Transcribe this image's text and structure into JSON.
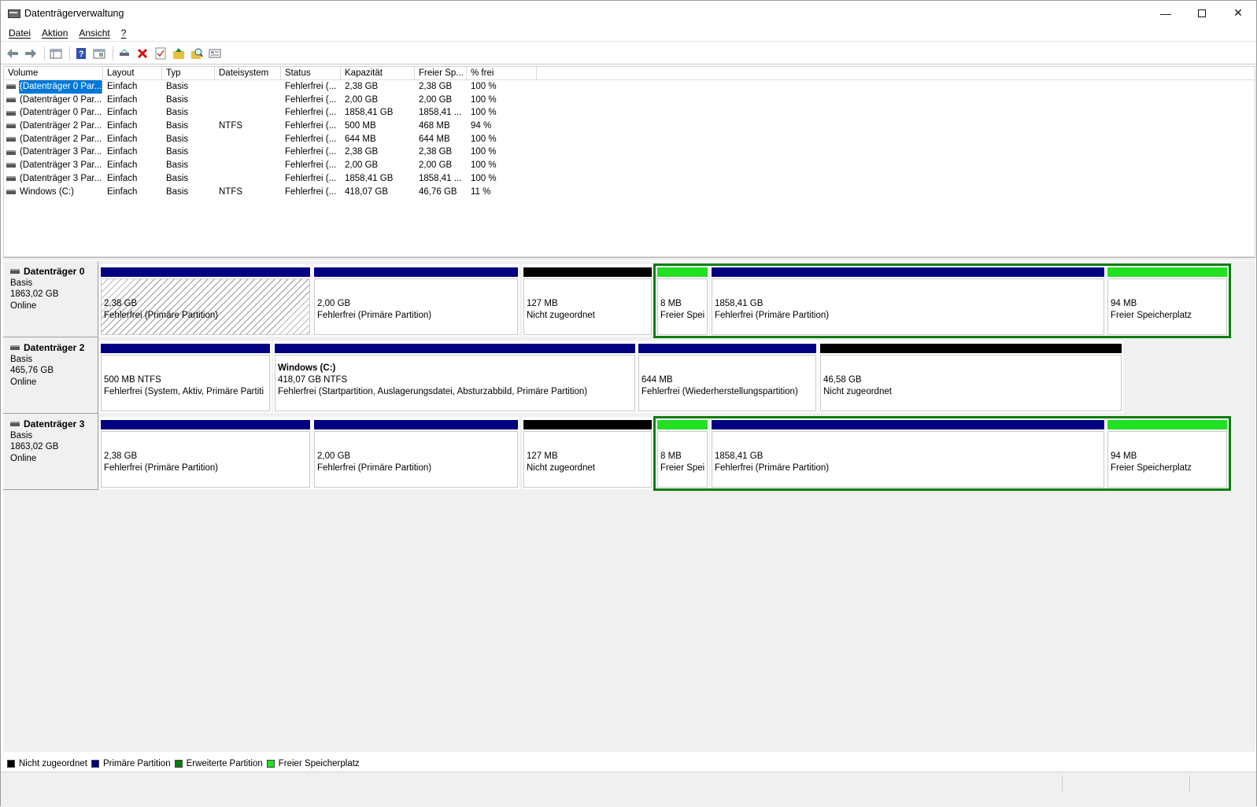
{
  "window": {
    "title": "Datenträgerverwaltung"
  },
  "menu": [
    "Datei",
    "Aktion",
    "Ansicht",
    "?"
  ],
  "volume_list": {
    "columns": [
      "Volume",
      "Layout",
      "Typ",
      "Dateisystem",
      "Status",
      "Kapazität",
      "Freier Sp...",
      "% frei"
    ],
    "rows": [
      [
        "(Datenträger 0 Par...",
        "Einfach",
        "Basis",
        "",
        "Fehlerfrei (...",
        "2,38 GB",
        "2,38 GB",
        "100 %"
      ],
      [
        "(Datenträger 0 Par...",
        "Einfach",
        "Basis",
        "",
        "Fehlerfrei (...",
        "2,00 GB",
        "2,00 GB",
        "100 %"
      ],
      [
        "(Datenträger 0 Par...",
        "Einfach",
        "Basis",
        "",
        "Fehlerfrei (...",
        "1858,41 GB",
        "1858,41 ...",
        "100 %"
      ],
      [
        "(Datenträger 2 Par...",
        "Einfach",
        "Basis",
        "NTFS",
        "Fehlerfrei (...",
        "500 MB",
        "468 MB",
        "94 %"
      ],
      [
        "(Datenträger 2 Par...",
        "Einfach",
        "Basis",
        "",
        "Fehlerfrei (...",
        "644 MB",
        "644 MB",
        "100 %"
      ],
      [
        "(Datenträger 3 Par...",
        "Einfach",
        "Basis",
        "",
        "Fehlerfrei (...",
        "2,38 GB",
        "2,38 GB",
        "100 %"
      ],
      [
        "(Datenträger 3 Par...",
        "Einfach",
        "Basis",
        "",
        "Fehlerfrei (...",
        "2,00 GB",
        "2,00 GB",
        "100 %"
      ],
      [
        "(Datenträger 3 Par...",
        "Einfach",
        "Basis",
        "",
        "Fehlerfrei (...",
        "1858,41 GB",
        "1858,41 ...",
        "100 %"
      ],
      [
        "Windows (C:)",
        "Einfach",
        "Basis",
        "NTFS",
        "Fehlerfrei (...",
        "418,07 GB",
        "46,76 GB",
        "11 %"
      ]
    ]
  },
  "disks": [
    {
      "name": "Datenträger 0",
      "type": "Basis",
      "size": "1863,02 GB",
      "state": "Online",
      "partitions": [
        {
          "line0": "",
          "line1": "2,38 GB",
          "line2": "Fehlerfrei (Primäre Partition)",
          "kind": "primary"
        },
        {
          "line0": "",
          "line1": "2,00 GB",
          "line2": "Fehlerfrei (Primäre Partition)",
          "kind": "primary"
        },
        {
          "line0": "",
          "line1": "127 MB",
          "line2": "Nicht zugeordnet",
          "kind": "unallocated"
        },
        {
          "line0": "",
          "line1": "8 MB",
          "line2": "Freier Spei",
          "kind": "free"
        },
        {
          "line0": "",
          "line1": "1858,41 GB",
          "line2": "Fehlerfrei (Primäre Partition)",
          "kind": "primary"
        },
        {
          "line0": "",
          "line1": "94 MB",
          "line2": "Freier Speicherplatz",
          "kind": "free"
        }
      ]
    },
    {
      "name": "Datenträger 2",
      "type": "Basis",
      "size": "465,76 GB",
      "state": "Online",
      "partitions": [
        {
          "line0": "",
          "line1": "500 MB NTFS",
          "line2": "Fehlerfrei (System, Aktiv, Primäre Partiti",
          "kind": "primary"
        },
        {
          "line0": "Windows  (C:)",
          "line1": "418,07 GB NTFS",
          "line2": "Fehlerfrei (Startpartition, Auslagerungsdatei, Absturzabbild, Primäre Partition)",
          "kind": "primary"
        },
        {
          "line0": "",
          "line1": "644 MB",
          "line2": "Fehlerfrei (Wiederherstellungspartition)",
          "kind": "primary"
        },
        {
          "line0": "",
          "line1": "46,58 GB",
          "line2": "Nicht zugeordnet",
          "kind": "unallocated"
        }
      ]
    },
    {
      "name": "Datenträger 3",
      "type": "Basis",
      "size": "1863,02 GB",
      "state": "Online",
      "partitions": [
        {
          "line0": "",
          "line1": "2,38 GB",
          "line2": "Fehlerfrei (Primäre Partition)",
          "kind": "primary"
        },
        {
          "line0": "",
          "line1": "2,00 GB",
          "line2": "Fehlerfrei (Primäre Partition)",
          "kind": "primary"
        },
        {
          "line0": "",
          "line1": "127 MB",
          "line2": "Nicht zugeordnet",
          "kind": "unallocated"
        },
        {
          "line0": "",
          "line1": "8 MB",
          "line2": "Freier Spei",
          "kind": "free"
        },
        {
          "line0": "",
          "line1": "1858,41 GB",
          "line2": "Fehlerfrei (Primäre Partition)",
          "kind": "primary"
        },
        {
          "line0": "",
          "line1": "94 MB",
          "line2": "Freier Speicherplatz",
          "kind": "free"
        }
      ]
    }
  ],
  "legend": [
    {
      "label": "Nicht zugeordnet",
      "color": "#000000"
    },
    {
      "label": "Primäre Partition",
      "color": "#000080"
    },
    {
      "label": "Erweiterte Partition",
      "color": "#0a7d0a"
    },
    {
      "label": "Freier Speicherplatz",
      "color": "#22e022"
    }
  ],
  "colors": {
    "primary": "#000080",
    "unallocated": "#000000",
    "free": "#22e022",
    "extended": "#0a7d0a",
    "selection": "#0078d7"
  },
  "toolbar_icons": [
    "back-arrow-icon",
    "forward-arrow-icon",
    "show-hide-console-tree-icon",
    "help-icon",
    "properties-pane-icon",
    "connect-disk-icon",
    "delete-icon",
    "properties-icon",
    "move-up-icon",
    "search-icon",
    "view-icon"
  ]
}
